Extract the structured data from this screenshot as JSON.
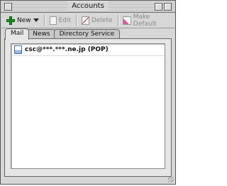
{
  "window": {
    "title": "Accounts"
  },
  "toolbar": {
    "new_label": "New",
    "edit_label": "Edit",
    "delete_label": "Delete",
    "make_default_label": "Make Default"
  },
  "tabs": [
    {
      "label": "Mail",
      "active": true
    },
    {
      "label": "News",
      "active": false
    },
    {
      "label": "Directory Service",
      "active": false
    }
  ],
  "accounts": [
    {
      "label": "csc@***.***.ne.jp (POP)"
    }
  ]
}
